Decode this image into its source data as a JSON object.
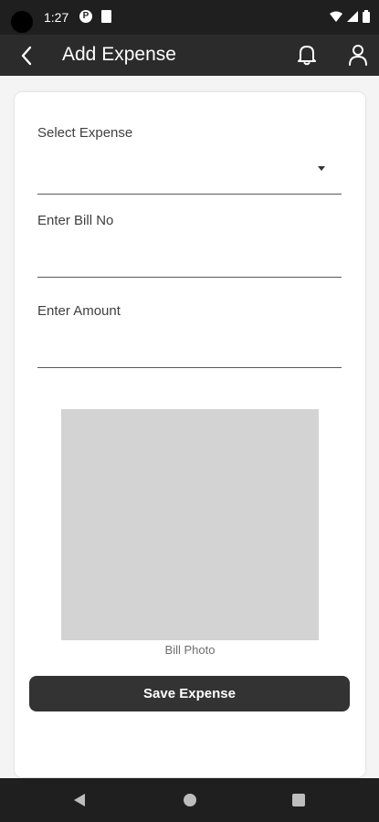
{
  "status_bar": {
    "time": "1:27",
    "notification_glyph": "P"
  },
  "app_bar": {
    "title": "Add Expense",
    "back_icon": "chevron-left-icon",
    "bell_icon": "bell-icon",
    "user_icon": "user-icon"
  },
  "form": {
    "select_expense": {
      "label": "Select Expense",
      "value": ""
    },
    "bill_no": {
      "label": "Enter Bill No",
      "value": ""
    },
    "amount": {
      "label": "Enter Amount",
      "value": ""
    }
  },
  "photo": {
    "caption": "Bill Photo"
  },
  "actions": {
    "save_label": "Save Expense"
  },
  "colors": {
    "app_bar_bg": "#2b2b2b",
    "status_bar_bg": "#1f1f1f",
    "button_bg": "#333333",
    "photo_placeholder": "#d3d3d3"
  }
}
